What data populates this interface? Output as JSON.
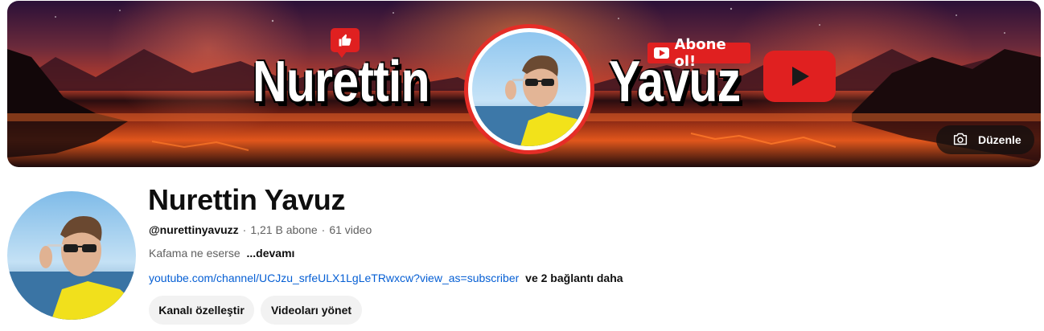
{
  "banner": {
    "left_word": "Nurettin",
    "right_word": "Yavuz",
    "subscribe_pill": "Abone ol!",
    "icons": [
      "thumbs-up-icon",
      "play-icon",
      "youtube-logo-icon",
      "camera-icon"
    ],
    "edit_label": "Düzenle"
  },
  "channel": {
    "name": "Nurettin Yavuz",
    "handle": "@nurettinyavuzz",
    "subscribers": "1,21 B abone",
    "videos": "61 video",
    "separator": "·",
    "description": "Kafama ne eserse",
    "more_label": "...devamı",
    "link_url": "youtube.com/channel/UCJzu_srfeULX1LgLeTRwxcw?view_as=subscriber",
    "more_links": "ve 2 bağlantı daha"
  },
  "actions": {
    "customize": "Kanalı özelleştir",
    "manage_videos": "Videoları yönet"
  },
  "colors": {
    "accent_red": "#e02020",
    "link_blue": "#065fd4",
    "secondary_text": "#606060",
    "button_bg": "#f2f2f2"
  }
}
